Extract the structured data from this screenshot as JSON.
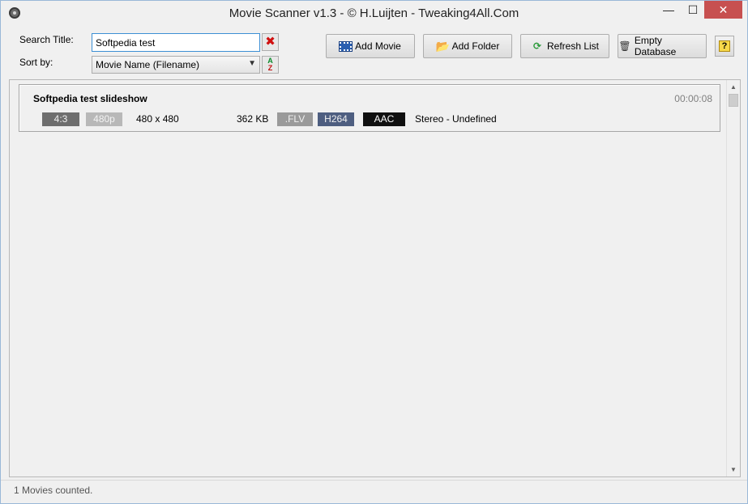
{
  "window": {
    "title": "Movie Scanner v1.3 - © H.Luijten - Tweaking4All.Com",
    "minimize_glyph": "—",
    "maximize_glyph": "☐",
    "close_glyph": "✕"
  },
  "search": {
    "label": "Search Title:",
    "value": "Softpedia test",
    "clear_glyph": "✖"
  },
  "sort": {
    "label": "Sort by:",
    "selected": "Movie Name (Filename)",
    "direction_top": "A",
    "direction_bottom": "Z"
  },
  "toolbar": {
    "add_movie": "Add Movie",
    "add_folder": "Add Folder",
    "refresh_list": "Refresh List",
    "empty_database": "Empty Database",
    "help_glyph": "?"
  },
  "movies": [
    {
      "title": "Softpedia test slideshow",
      "duration": "00:00:08",
      "aspect": "4:3",
      "resolution_class": "480p",
      "dimensions": "480 x 480",
      "size": "362 KB",
      "container": ".FLV",
      "video_codec": "H264",
      "audio_codec": "AAC",
      "audio_channels": "Stereo - Undefined"
    }
  ],
  "status": {
    "text": "1 Movies counted."
  },
  "icons": {
    "app": "film-reel-icon",
    "add_movie": "film-strip-icon",
    "add_folder": "folder-icon",
    "refresh": "refresh-icon",
    "trash": "trash-icon",
    "help": "help-icon"
  },
  "colors": {
    "accent_border": "#3c8fd4",
    "close_button": "#c75050",
    "clear_x": "#d01010"
  }
}
